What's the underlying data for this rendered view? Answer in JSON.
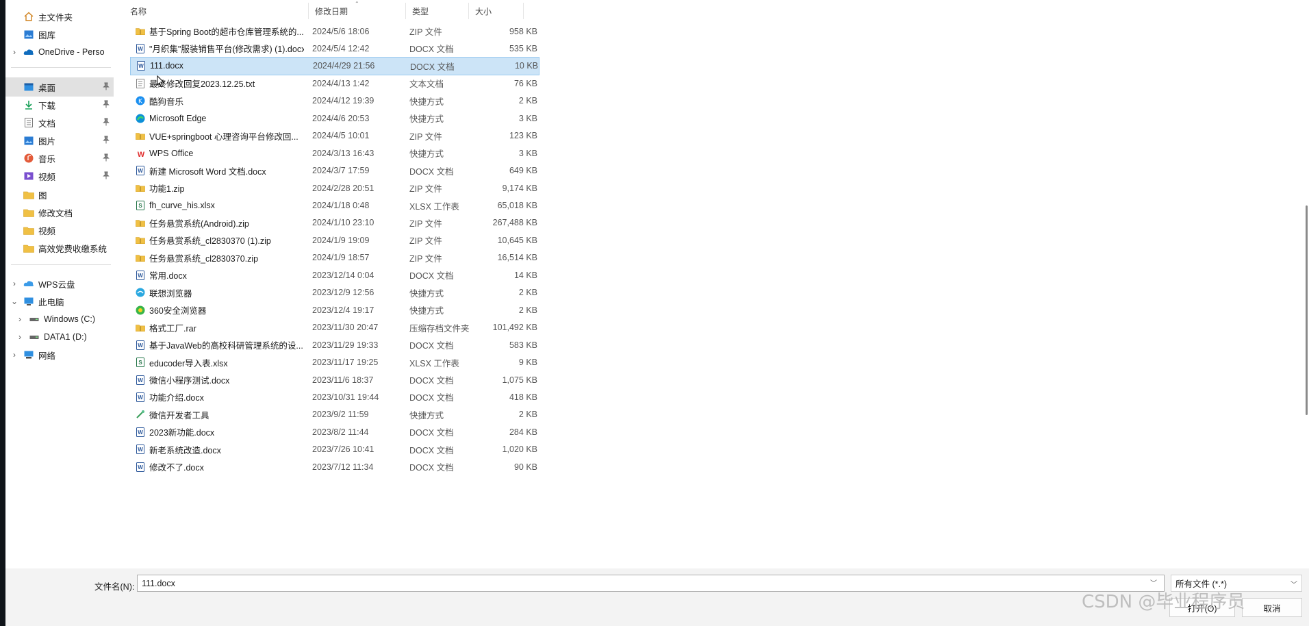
{
  "sidebar": {
    "items": [
      {
        "label": "主文件夹",
        "icon": "home-icon",
        "chevron": "",
        "pinned": false,
        "active": false
      },
      {
        "label": "图库",
        "icon": "gallery-icon",
        "chevron": "",
        "pinned": false,
        "active": false
      },
      {
        "label": "OneDrive - Perso",
        "icon": "cloud-icon",
        "chevron": "›",
        "pinned": false,
        "active": false
      },
      {
        "label": "桌面",
        "icon": "desktop-icon",
        "chevron": "",
        "pinned": true,
        "active": true
      },
      {
        "label": "下载",
        "icon": "download-icon",
        "chevron": "",
        "pinned": true,
        "active": false
      },
      {
        "label": "文档",
        "icon": "document-icon",
        "chevron": "",
        "pinned": true,
        "active": false
      },
      {
        "label": "图片",
        "icon": "picture-icon",
        "chevron": "",
        "pinned": true,
        "active": false
      },
      {
        "label": "音乐",
        "icon": "music-icon",
        "chevron": "",
        "pinned": true,
        "active": false
      },
      {
        "label": "视频",
        "icon": "video-icon",
        "chevron": "",
        "pinned": true,
        "active": false
      },
      {
        "label": "图",
        "icon": "folder-icon",
        "chevron": "",
        "pinned": false,
        "active": false
      },
      {
        "label": "修改文档",
        "icon": "folder-icon",
        "chevron": "",
        "pinned": false,
        "active": false
      },
      {
        "label": "视频",
        "icon": "folder-icon",
        "chevron": "",
        "pinned": false,
        "active": false
      },
      {
        "label": "高效党费收缴系统",
        "icon": "folder-icon",
        "chevron": "",
        "pinned": false,
        "active": false
      },
      {
        "label": "WPS云盘",
        "icon": "wps-cloud-icon",
        "chevron": "›",
        "pinned": false,
        "active": false
      },
      {
        "label": "此电脑",
        "icon": "computer-icon",
        "chevron": "⌄",
        "pinned": false,
        "active": false
      },
      {
        "label": "Windows (C:)",
        "icon": "drive-icon",
        "chevron": "›",
        "pinned": false,
        "active": false
      },
      {
        "label": "DATA1 (D:)",
        "icon": "drive-icon",
        "chevron": "›",
        "pinned": false,
        "active": false
      },
      {
        "label": "网络",
        "icon": "network-icon",
        "chevron": "›",
        "pinned": false,
        "active": false
      }
    ]
  },
  "filelist": {
    "columns": {
      "name": "名称",
      "date": "修改日期",
      "type": "类型",
      "size": "大小"
    },
    "rows": [
      {
        "name": "基于Spring Boot的超市仓库管理系统的...",
        "date": "2024/5/6 18:06",
        "type": "ZIP 文件",
        "size": "958 KB",
        "icon": "zip-icon",
        "selected": false
      },
      {
        "name": "\"月织集\"服装销售平台(修改需求) (1).docx",
        "date": "2024/5/4 12:42",
        "type": "DOCX 文档",
        "size": "535 KB",
        "icon": "word-icon",
        "selected": false
      },
      {
        "name": "111.docx",
        "date": "2024/4/29 21:56",
        "type": "DOCX 文档",
        "size": "10 KB",
        "icon": "word-icon",
        "selected": true
      },
      {
        "name": "最终修改回复2023.12.25.txt",
        "date": "2024/4/13 1:42",
        "type": "文本文档",
        "size": "76 KB",
        "icon": "text-file-icon",
        "selected": false
      },
      {
        "name": "酷狗音乐",
        "date": "2024/4/12 19:39",
        "type": "快捷方式",
        "size": "2 KB",
        "icon": "kugou-icon",
        "selected": false
      },
      {
        "name": "Microsoft Edge",
        "date": "2024/4/6 20:53",
        "type": "快捷方式",
        "size": "3 KB",
        "icon": "edge-icon",
        "selected": false
      },
      {
        "name": "VUE+springboot 心理咨询平台修改回...",
        "date": "2024/4/5 10:01",
        "type": "ZIP 文件",
        "size": "123 KB",
        "icon": "zip-icon",
        "selected": false
      },
      {
        "name": "WPS Office",
        "date": "2024/3/13 16:43",
        "type": "快捷方式",
        "size": "3 KB",
        "icon": "wps-icon",
        "selected": false
      },
      {
        "name": "新建 Microsoft Word 文档.docx",
        "date": "2024/3/7 17:59",
        "type": "DOCX 文档",
        "size": "649 KB",
        "icon": "word-icon",
        "selected": false
      },
      {
        "name": "功能1.zip",
        "date": "2024/2/28 20:51",
        "type": "ZIP 文件",
        "size": "9,174 KB",
        "icon": "zip-icon",
        "selected": false
      },
      {
        "name": "fh_curve_his.xlsx",
        "date": "2024/1/18 0:48",
        "type": "XLSX 工作表",
        "size": "65,018 KB",
        "icon": "excel-icon",
        "selected": false
      },
      {
        "name": "任务悬赏系统(Android).zip",
        "date": "2024/1/10 23:10",
        "type": "ZIP 文件",
        "size": "267,488 KB",
        "icon": "zip-icon",
        "selected": false
      },
      {
        "name": "任务悬赏系统_cl2830370 (1).zip",
        "date": "2024/1/9 19:09",
        "type": "ZIP 文件",
        "size": "10,645 KB",
        "icon": "zip-icon",
        "selected": false
      },
      {
        "name": "任务悬赏系统_cl2830370.zip",
        "date": "2024/1/9 18:57",
        "type": "ZIP 文件",
        "size": "16,514 KB",
        "icon": "zip-icon",
        "selected": false
      },
      {
        "name": "常用.docx",
        "date": "2023/12/14 0:04",
        "type": "DOCX 文档",
        "size": "14 KB",
        "icon": "word-icon",
        "selected": false
      },
      {
        "name": "联想浏览器",
        "date": "2023/12/9 12:56",
        "type": "快捷方式",
        "size": "2 KB",
        "icon": "lenovo-browser-icon",
        "selected": false
      },
      {
        "name": "360安全浏览器",
        "date": "2023/12/4 19:17",
        "type": "快捷方式",
        "size": "2 KB",
        "icon": "browser-360-icon",
        "selected": false
      },
      {
        "name": "格式工厂.rar",
        "date": "2023/11/30 20:47",
        "type": "压缩存档文件夹",
        "size": "101,492 KB",
        "icon": "zip-icon",
        "selected": false
      },
      {
        "name": "基于JavaWeb的高校科研管理系统的设...",
        "date": "2023/11/29 19:33",
        "type": "DOCX 文档",
        "size": "583 KB",
        "icon": "word-icon",
        "selected": false
      },
      {
        "name": "educoder导入表.xlsx",
        "date": "2023/11/17 19:25",
        "type": "XLSX 工作表",
        "size": "9 KB",
        "icon": "excel-icon",
        "selected": false
      },
      {
        "name": "微信小程序测试.docx",
        "date": "2023/11/6 18:37",
        "type": "DOCX 文档",
        "size": "1,075 KB",
        "icon": "word-icon",
        "selected": false
      },
      {
        "name": "功能介绍.docx",
        "date": "2023/10/31 19:44",
        "type": "DOCX 文档",
        "size": "418 KB",
        "icon": "word-icon",
        "selected": false
      },
      {
        "name": "微信开发者工具",
        "date": "2023/9/2 11:59",
        "type": "快捷方式",
        "size": "2 KB",
        "icon": "wechat-devtools-icon",
        "selected": false
      },
      {
        "name": "2023新功能.docx",
        "date": "2023/8/2 11:44",
        "type": "DOCX 文档",
        "size": "284 KB",
        "icon": "word-icon",
        "selected": false
      },
      {
        "name": "新老系统改造.docx",
        "date": "2023/7/26 10:41",
        "type": "DOCX 文档",
        "size": "1,020 KB",
        "icon": "word-icon",
        "selected": false
      },
      {
        "name": "修改不了.docx",
        "date": "2023/7/12 11:34",
        "type": "DOCX 文档",
        "size": "90 KB",
        "icon": "word-icon",
        "selected": false
      }
    ]
  },
  "bottom": {
    "filename_label": "文件名(N):",
    "filename_value": "111.docx",
    "filetype_value": "所有文件 (*.*)",
    "open_label": "打开(O)",
    "cancel_label": "取消"
  },
  "watermark": "CSDN @毕业程序员",
  "colors": {
    "selection": "#cce4f7",
    "folder": "#f0c044",
    "word": "#2b579a",
    "excel": "#217346"
  }
}
